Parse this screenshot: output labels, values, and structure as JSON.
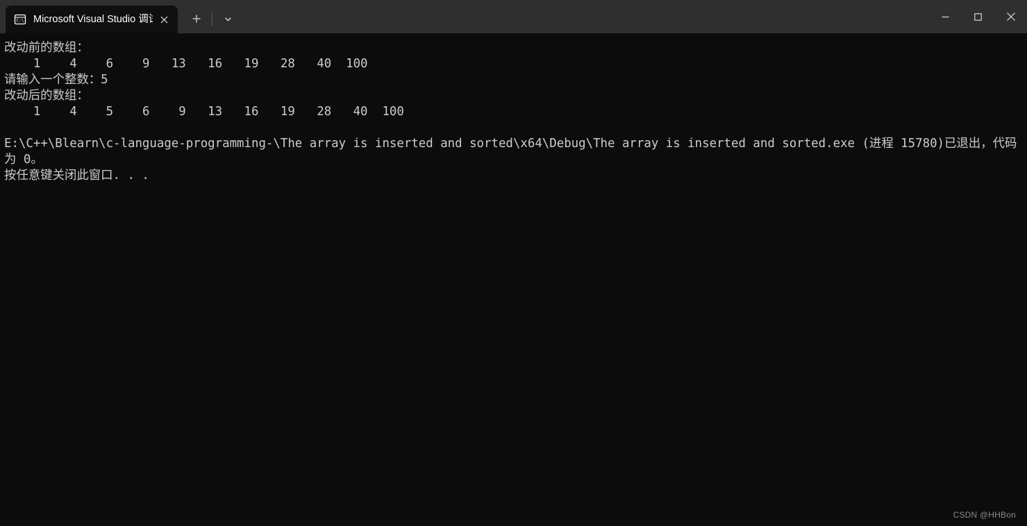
{
  "window": {
    "titlebar_bg": "#2f2f2f",
    "tab_bg": "#0f0f0f",
    "console_bg": "#0c0c0c",
    "console_fg": "#cccccc",
    "tab": {
      "icon": "console-cmd-icon",
      "title": "Microsoft Visual Studio 调试控",
      "close_label": "关闭选项卡"
    },
    "new_tab_label": "新建标签页",
    "tab_menu_label": "打开新标签页下拉菜单",
    "controls": {
      "minimize": "最小化",
      "maximize": "最大化",
      "close": "关闭"
    }
  },
  "console": {
    "lines": [
      "改动前的数组：",
      "    1    4    6    9   13   16   19   28   40  100",
      "请输入一个整数：5",
      "改动后的数组：",
      "    1    4    5    6    9   13   16   19   28   40  100",
      "",
      "E:\\C++\\Blearn\\c-language-programming-\\The array is inserted and sorted\\x64\\Debug\\The array is inserted and sorted.exe (进程 15780)已退出，代码为 0。",
      "按任意键关闭此窗口. . ."
    ],
    "text": "改动前的数组：\n    1    4    6    9   13   16   19   28   40  100\n请输入一个整数：5\n改动后的数组：\n    1    4    5    6    9   13   16   19   28   40  100\n\nE:\\C++\\Blearn\\c-language-programming-\\The array is inserted and sorted\\x64\\Debug\\The array is inserted and sorted.exe (进程 15780)已退出，代码为 0。\n按任意键关闭此窗口. . .",
    "array_before": [
      1,
      4,
      6,
      9,
      13,
      16,
      19,
      28,
      40,
      100
    ],
    "array_after": [
      1,
      4,
      5,
      6,
      9,
      13,
      16,
      19,
      28,
      40,
      100
    ],
    "inserted_value": "5",
    "prompt": "请输入一个整数：",
    "exe_path": "E:\\C++\\Blearn\\c-language-programming-\\The array is inserted and sorted\\x64\\Debug\\The array is inserted and sorted.exe",
    "process_id": "15780",
    "exit_code": "0",
    "exit_message": "进程 15780)已退出，代码为 0。",
    "close_message": "按任意键关闭此窗口. . ."
  },
  "watermark": {
    "text": "CSDN @HHBon"
  }
}
